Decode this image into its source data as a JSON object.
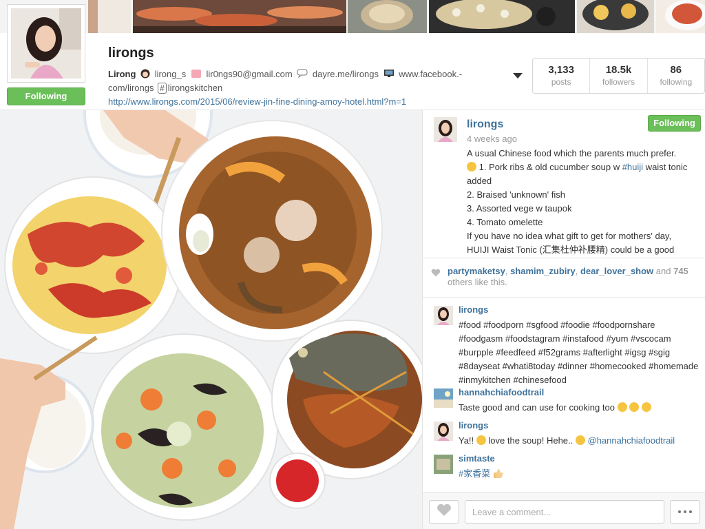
{
  "profile": {
    "username": "lirongs",
    "follow_label": "Following",
    "bio": {
      "name": "Lirong",
      "handle": "lirong_s",
      "email": "lir0ngs90@gmail.com",
      "dayre": "dayre.me/lirongs",
      "facebook_part1": "www.facebook.-",
      "facebook_part2": "com/lirongs",
      "hashtag": "lirongskitchen",
      "link": "http://www.lirongs.com/2015/06/review-jin-fine-dining-amoy-hotel.html?m=1"
    },
    "stats": [
      {
        "value": "3,133",
        "label": "posts"
      },
      {
        "value": "18.5k",
        "label": "followers"
      },
      {
        "value": "86",
        "label": "following"
      }
    ]
  },
  "post": {
    "user": "lirongs",
    "time_ago": "4 weeks ago",
    "follow_label": "Following",
    "caption_lines": [
      "A usual Chinese food which the parents much prefer.",
      " 1. Pork ribs & old cucumber soup w ",
      "2. Braised 'unknown' fish",
      "3. Assorted vege w taupok",
      "4. Tomato omelette",
      "If you have no idea what gift to get for mothers' day,",
      "HUIJI Waist Tonic (汇集杜仲补腰精) could be a good"
    ],
    "caption_hashtag": "#huiji",
    "caption_line2_tail": " waist tonic added",
    "likes": {
      "users": [
        "partymaketsy",
        "shamim_zubiry",
        "dear_lover_show"
      ],
      "and_text": " and ",
      "count": "745",
      "suffix": "others like this."
    },
    "comments": [
      {
        "user": "lirongs",
        "text": "#food #foodporn #sgfood #foodie #foodpornshare #foodgasm #foodstagram #instafood #yum #vscocam #burpple #feedfeed #f52grams #afterlight #igsg #sgig #8dayseat #whati8today #dinner #homecooked #homemade #inmykitchen #chinesefood"
      },
      {
        "user": "hannahchiafoodtrail",
        "text": "Taste good and can use for cooking too"
      },
      {
        "user": "lirongs",
        "text_before": "Ya!! ",
        "text_mid": " love the soup! Hehe.. ",
        "mention": "@hannahchiafoodtrail"
      },
      {
        "user": "simtaste",
        "text": "#家香菜"
      }
    ],
    "comment_placeholder": "Leave a comment..."
  },
  "icons": {
    "heart": "heart-icon",
    "more": "more-dots-icon",
    "expand": "chevron-down-icon"
  }
}
